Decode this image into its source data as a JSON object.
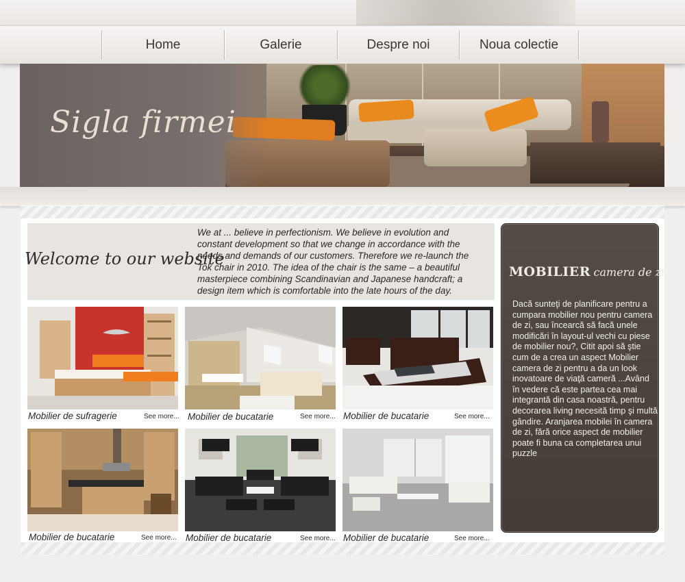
{
  "nav": {
    "items": [
      {
        "label": "Home"
      },
      {
        "label": "Galerie"
      },
      {
        "label": "Despre noi"
      },
      {
        "label": "Noua colectie"
      }
    ]
  },
  "banner": {
    "logo_text": "Sigla firmei"
  },
  "welcome": {
    "title": "Welcome to our website",
    "text": "We at ... believe in perfectionism. We believe in evolution and constant development so that we change in accordance with the needs and demands of our customers. Therefore we re-launch the Tok chair in 2010. The idea of the chair is the same – a beautiful masterpiece combining Scandinavian and Japanese handcraft; a design item which is comfortable into the late hours of the day."
  },
  "gallery": [
    {
      "caption": "Mobilier de sufragerie",
      "more": "See more..."
    },
    {
      "caption": "Mobilier de bucatarie",
      "more": "See more..."
    },
    {
      "caption": "Mobilier de bucatarie",
      "more": "See more..."
    },
    {
      "caption": "Mobilier de bucatarie",
      "more": "See more..."
    },
    {
      "caption": "Mobilier de bucatarie",
      "more": "See more..."
    },
    {
      "caption": "Mobilier de bucatarie",
      "more": "See more..."
    }
  ],
  "sidebar": {
    "title_big": "MOBILIER",
    "title_small": "camera de zi",
    "text": "Dacă sunteţi de planificare pentru a cumpara mobilier nou pentru camera de zi, sau încearcă să facă unele modificări în layout-ul vechi cu piese de mobilier nou?, Citit apoi să ştie cum de a crea un aspect Mobilier camera de zi pentru a da un look inovatoare de viaţă cameră ...Având în vedere că este partea cea mai integrantă din casa noastră, pentru decorarea living necesită timp şi multă gândire. Aranjarea mobilei în camera de zi, fără orice aspect de mobilier poate fi buna ca completarea unui puzzle"
  },
  "colors": {
    "accent_orange": "#e88a1d",
    "sidebar_bg": "#4a423d",
    "page_bg": "#f1efed"
  }
}
